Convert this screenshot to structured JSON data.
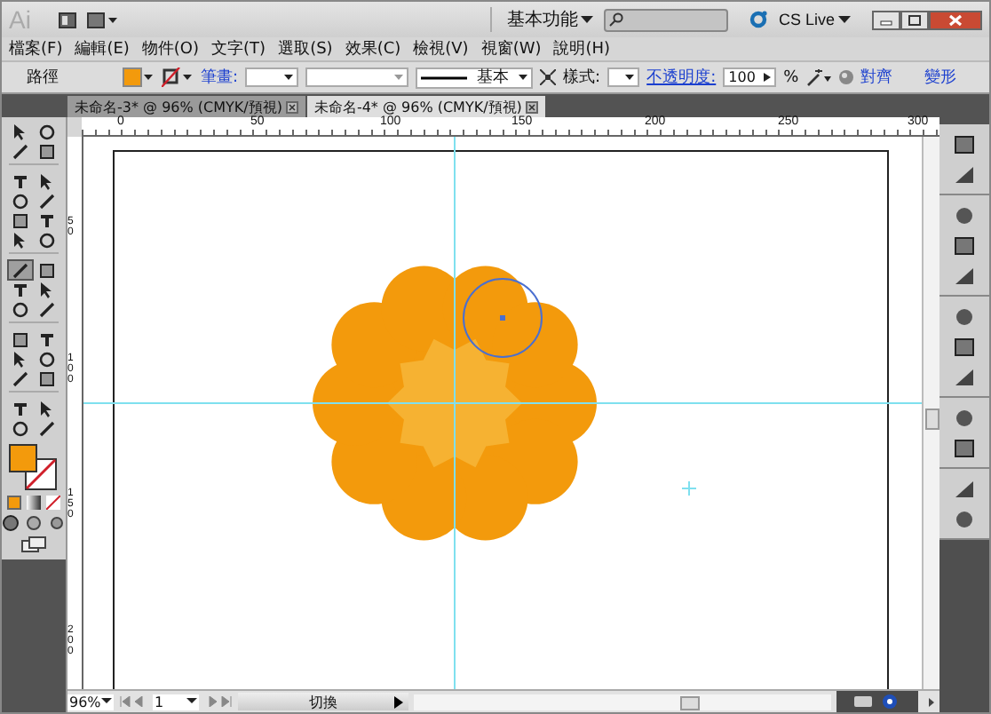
{
  "title_bar": {
    "logo": "Ai",
    "workspace": "基本功能",
    "cs_live": "CS Live"
  },
  "menu": [
    "檔案(F)",
    "編輯(E)",
    "物件(O)",
    "文字(T)",
    "選取(S)",
    "效果(C)",
    "檢視(V)",
    "視窗(W)",
    "說明(H)"
  ],
  "control_bar": {
    "label": "路徑",
    "stroke_label": "筆畫:",
    "line_style": "基本",
    "style_label": "樣式:",
    "opacity_label": "不透明度:",
    "opacity": "100",
    "percent": "%",
    "align": "對齊",
    "transform": "變形"
  },
  "tabs": [
    {
      "label": "未命名-3* @ 96% (CMYK/預視)",
      "selected": false
    },
    {
      "label": "未命名-4* @ 96% (CMYK/預視)",
      "selected": true
    }
  ],
  "tools": [
    {
      "selected": false
    },
    {
      "selected": false
    },
    {
      "selected": false
    },
    {
      "selected": false
    },
    {
      "selected": false
    },
    {
      "selected": false
    },
    {
      "selected": false
    },
    {
      "selected": false
    },
    {
      "selected": false
    },
    {
      "selected": false
    },
    {
      "selected": false
    },
    {
      "selected": false
    },
    {
      "selected": true
    },
    {
      "selected": false
    },
    {
      "selected": false
    },
    {
      "selected": false
    },
    {
      "selected": false
    },
    {
      "selected": false
    },
    {
      "selected": false
    },
    {
      "selected": false
    },
    {
      "selected": false
    },
    {
      "selected": false
    },
    {
      "selected": false
    },
    {
      "selected": false
    },
    {
      "selected": false
    },
    {
      "selected": false
    },
    {
      "selected": false
    },
    {
      "selected": false
    }
  ],
  "ruler": {
    "horizontal": [
      "0",
      "50",
      "100",
      "150",
      "200",
      "250",
      "300"
    ],
    "vertical": [
      "50",
      "100",
      "150",
      "200"
    ]
  },
  "status_bar": {
    "zoom": "96%",
    "page": "1",
    "mode": "切換"
  }
}
